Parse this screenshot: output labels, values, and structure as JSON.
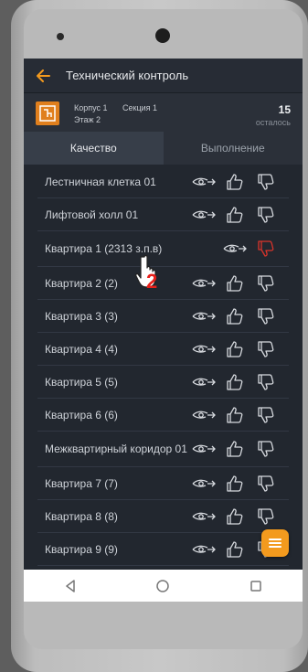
{
  "app": {
    "title": "Технический контроль"
  },
  "info": {
    "building": "Корпус 1",
    "section": "Секция 1",
    "floor": "Этаж 2",
    "remaining_count": "15",
    "remaining_label": "осталось"
  },
  "tabs": [
    {
      "label": "Качество",
      "active": true
    },
    {
      "label": "Выполнение",
      "active": false
    }
  ],
  "rows": [
    {
      "label": "Лестничная клетка 01",
      "status": "pending"
    },
    {
      "label": "Лифтовой холл 01",
      "status": "pending"
    },
    {
      "label": "Квартира 1 (2313 з.п.в)",
      "status": "rejected"
    },
    {
      "label": "Квартира 2 (2)",
      "status": "pending"
    },
    {
      "label": "Квартира 3 (3)",
      "status": "pending"
    },
    {
      "label": "Квартира 4 (4)",
      "status": "pending"
    },
    {
      "label": "Квартира 5 (5)",
      "status": "pending"
    },
    {
      "label": "Квартира 6 (6)",
      "status": "pending"
    },
    {
      "label": "Межквартирный коридор 01",
      "status": "pending"
    },
    {
      "label": "Квартира 7 (7)",
      "status": "pending"
    },
    {
      "label": "Квартира 8 (8)",
      "status": "pending"
    },
    {
      "label": "Квартира 9 (9)",
      "status": "pending"
    }
  ],
  "annotation": {
    "step_number": "2"
  },
  "colors": {
    "accent": "#f39a1e",
    "reject": "#d9342b",
    "icon": "#d7dadf"
  }
}
